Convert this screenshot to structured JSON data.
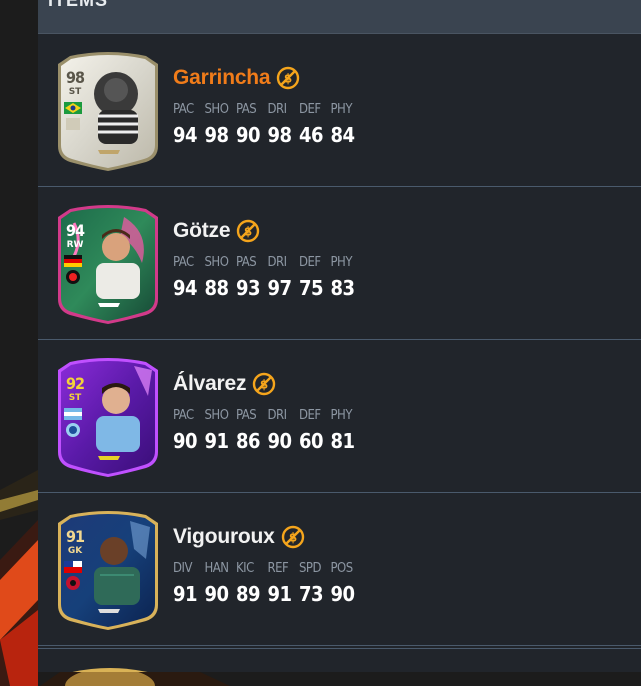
{
  "header": {
    "title": "ITEMS"
  },
  "colors": {
    "highlight_name": "#f07c1a",
    "default_name": "#f2f2f2",
    "untradeable_icon": "#f5a51c",
    "stat_label": "#8c96a2"
  },
  "items": [
    {
      "name": "Garrincha",
      "highlighted": true,
      "card": {
        "rating": "98",
        "position": "ST",
        "theme": "icon-white",
        "nation_flag": "brazil-flag-icon"
      },
      "stats": [
        {
          "label": "PAC",
          "value": "94"
        },
        {
          "label": "SHO",
          "value": "98"
        },
        {
          "label": "PAS",
          "value": "90"
        },
        {
          "label": "DRI",
          "value": "98"
        },
        {
          "label": "DEF",
          "value": "46"
        },
        {
          "label": "PHY",
          "value": "84"
        }
      ]
    },
    {
      "name": "Götze",
      "highlighted": false,
      "card": {
        "rating": "94",
        "position": "RW",
        "theme": "green-pink",
        "nation_flag": "germany-flag-icon"
      },
      "stats": [
        {
          "label": "PAC",
          "value": "94"
        },
        {
          "label": "SHO",
          "value": "88"
        },
        {
          "label": "PAS",
          "value": "93"
        },
        {
          "label": "DRI",
          "value": "97"
        },
        {
          "label": "DEF",
          "value": "75"
        },
        {
          "label": "PHY",
          "value": "83"
        }
      ]
    },
    {
      "name": "Álvarez",
      "highlighted": false,
      "card": {
        "rating": "92",
        "position": "ST",
        "theme": "purple",
        "nation_flag": "argentina-flag-icon"
      },
      "stats": [
        {
          "label": "PAC",
          "value": "90"
        },
        {
          "label": "SHO",
          "value": "91"
        },
        {
          "label": "PAS",
          "value": "86"
        },
        {
          "label": "DRI",
          "value": "90"
        },
        {
          "label": "DEF",
          "value": "60"
        },
        {
          "label": "PHY",
          "value": "81"
        }
      ]
    },
    {
      "name": "Vigouroux",
      "highlighted": false,
      "card": {
        "rating": "91",
        "position": "GK",
        "theme": "blue-gold",
        "nation_flag": "chile-flag-icon"
      },
      "stats": [
        {
          "label": "DIV",
          "value": "91"
        },
        {
          "label": "HAN",
          "value": "90"
        },
        {
          "label": "KIC",
          "value": "89"
        },
        {
          "label": "REF",
          "value": "91"
        },
        {
          "label": "SPD",
          "value": "73"
        },
        {
          "label": "POS",
          "value": "90"
        }
      ]
    }
  ]
}
